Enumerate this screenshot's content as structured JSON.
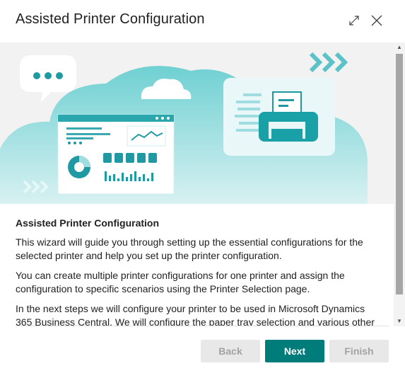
{
  "dialog": {
    "title": "Assisted Printer Configuration",
    "icons": {
      "expand": "expand-icon",
      "close": "close-icon"
    }
  },
  "content": {
    "heading": "Assisted Printer Configuration",
    "paragraphs": [
      "This wizard will guide you through setting up the essential configurations for the selected printer and help you set up the printer configuration.",
      "You can create multiple printer configurations for one printer and assign the configuration to specific scenarios using the Printer Selection page.",
      "In the next steps we will configure your printer to be used in Microsoft Dynamics 365 Business Central. We will configure the paper tray selection and various other"
    ]
  },
  "buttons": {
    "back": "Back",
    "next": "Next",
    "finish": "Finish"
  },
  "colors": {
    "accent": "#007d7b",
    "illustration_teal": "#5bc2c7",
    "disabled_bg": "#e8e8e8",
    "disabled_text": "#a3a3a3"
  }
}
